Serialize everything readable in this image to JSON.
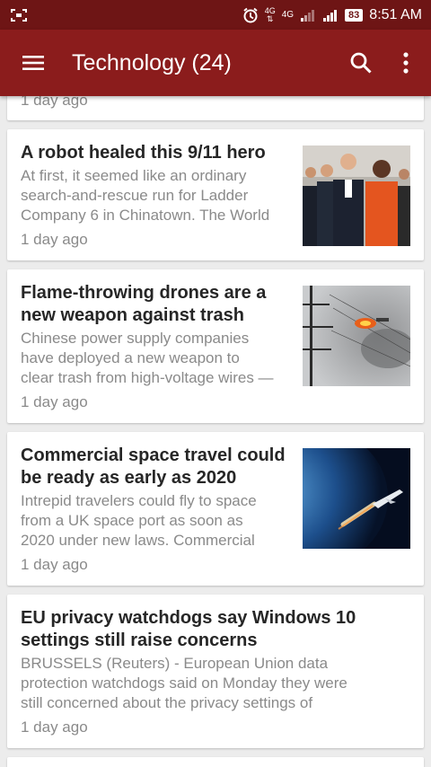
{
  "status_bar": {
    "net_top": "4G",
    "net_mid": "4G",
    "battery": "83",
    "time": "8:51 AM"
  },
  "app_bar": {
    "title": "Technology (24)"
  },
  "feed": {
    "partial_time": "1 day ago",
    "articles": [
      {
        "headline": "A robot healed this 9/11 hero",
        "summary_lines": [
          "At first, it seemed like an ordinary",
          "search-and-rescue run for Ladder",
          "Company 6 in Chinatown. The World"
        ],
        "time": "1 day ago",
        "image": "firefighters-photo"
      },
      {
        "headline_lines": [
          "Flame-throwing drones are a",
          "new weapon against trash"
        ],
        "summary_lines": [
          "Chinese power supply companies",
          "have deployed a new weapon to",
          "clear trash from high-voltage wires —"
        ],
        "time": "1 day ago",
        "image": "drone-powerline-photo"
      },
      {
        "headline_lines": [
          "Commercial space travel could",
          "be ready as early as 2020"
        ],
        "summary_lines": [
          "Intrepid travelers could fly to space",
          "from a UK space port as soon as",
          "2020 under new laws. Commercial"
        ],
        "time": "1 day ago",
        "image": "spaceplane-earth-photo"
      },
      {
        "headline_lines": [
          "EU privacy watchdogs say Windows 10",
          "settings still raise concerns"
        ],
        "summary_lines": [
          "BRUSSELS (Reuters) - European Union data",
          "protection watchdogs said on Monday they were",
          "still concerned about the privacy settings of"
        ],
        "time": "1 day ago"
      }
    ]
  },
  "colors": {
    "status_bar": "#6e1515",
    "app_bar": "#8b1c1c",
    "headline": "#262626",
    "secondary_text": "#8a8a8a",
    "background": "#ececec"
  }
}
